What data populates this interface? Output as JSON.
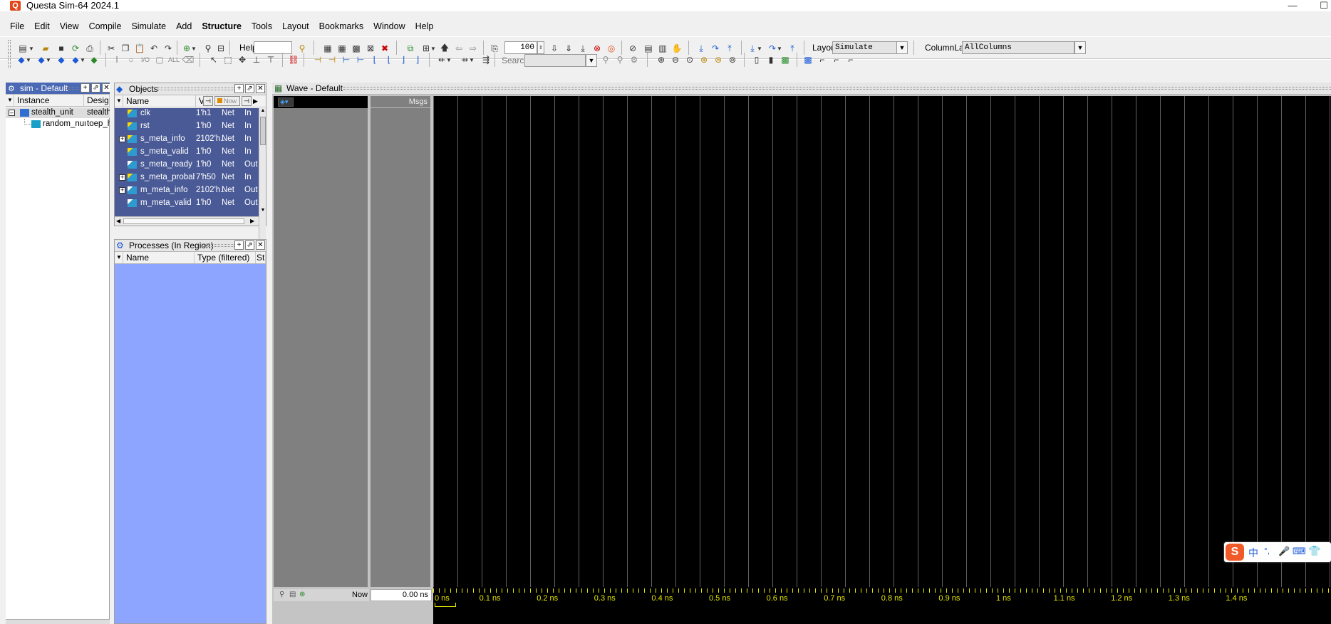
{
  "window": {
    "title": "Questa Sim-64 2024.1",
    "minimize": "—",
    "maximize": "☐"
  },
  "menu": [
    "File",
    "Edit",
    "View",
    "Compile",
    "Simulate",
    "Add",
    "Structure",
    "Tools",
    "Layout",
    "Bookmarks",
    "Window",
    "Help"
  ],
  "toolbar": {
    "help_label": "Help",
    "help_value": "",
    "run_length": "100",
    "layout_label": "Layout",
    "layout_value": "Simulate",
    "column_layout_label": "ColumnLayout",
    "column_layout_value": "AllColumns",
    "search_label": "Search:",
    "search_value": ""
  },
  "sim_pane": {
    "title": "sim - Default",
    "columns": [
      "Instance",
      "Design u"
    ],
    "rows": [
      {
        "instance": "stealth_unit",
        "design": "stealth_"
      },
      {
        "instance": "random_num_...",
        "design": "toep_has"
      }
    ]
  },
  "objects_pane": {
    "title": "Objects",
    "columns": [
      "Name",
      "Va"
    ],
    "now_label": "Now",
    "rows": [
      {
        "name": "clk",
        "value": "1'h1",
        "kind": "Net",
        "mode": "In",
        "expandable": false,
        "icon": "input-signal-icon"
      },
      {
        "name": "rst",
        "value": "1'h0",
        "kind": "Net",
        "mode": "In",
        "expandable": false,
        "icon": "input-signal-icon"
      },
      {
        "name": "s_meta_info",
        "value": "2102'h...",
        "kind": "Net",
        "mode": "In",
        "expandable": true,
        "icon": "input-signal-icon"
      },
      {
        "name": "s_meta_valid",
        "value": "1'h0",
        "kind": "Net",
        "mode": "In",
        "expandable": false,
        "icon": "input-signal-icon"
      },
      {
        "name": "s_meta_ready",
        "value": "1'h0",
        "kind": "Net",
        "mode": "Out",
        "expandable": false,
        "icon": "output-signal-icon"
      },
      {
        "name": "s_meta_probability",
        "value": "7'h50",
        "kind": "Net",
        "mode": "In",
        "expandable": true,
        "icon": "input-signal-icon"
      },
      {
        "name": "m_meta_info",
        "value": "2102'h...",
        "kind": "Net",
        "mode": "Out",
        "expandable": true,
        "icon": "output-signal-icon"
      },
      {
        "name": "m_meta_valid",
        "value": "1'h0",
        "kind": "Net",
        "mode": "Out",
        "expandable": false,
        "icon": "output-signal-icon"
      }
    ]
  },
  "processes_pane": {
    "title": "Processes (In Region)",
    "columns": [
      "Name",
      "Type (filtered)",
      "Sta"
    ]
  },
  "wave_pane": {
    "title": "Wave - Default",
    "msgs_label": "Msgs",
    "now_label": "Now",
    "now_value": "0.00 ns",
    "ticks": [
      "0 ns",
      "0.1 ns",
      "0.2 ns",
      "0.3 ns",
      "0.4 ns",
      "0.5 ns",
      "0.6 ns",
      "0.7 ns",
      "0.8 ns",
      "0.9 ns",
      "1 ns",
      "1.1 ns",
      "1.2 ns",
      "1.3 ns",
      "1.4 ns"
    ]
  },
  "ime_bar": {
    "logo": "S",
    "lang": "中",
    "punct": "°,"
  },
  "colors": {
    "selection": "#4a5a96",
    "process_bg": "#8da5ff",
    "wave_bg": "#000000",
    "signal_panel": "#808080",
    "active_title": "#4a68b4",
    "ruler": "#e7e700"
  }
}
